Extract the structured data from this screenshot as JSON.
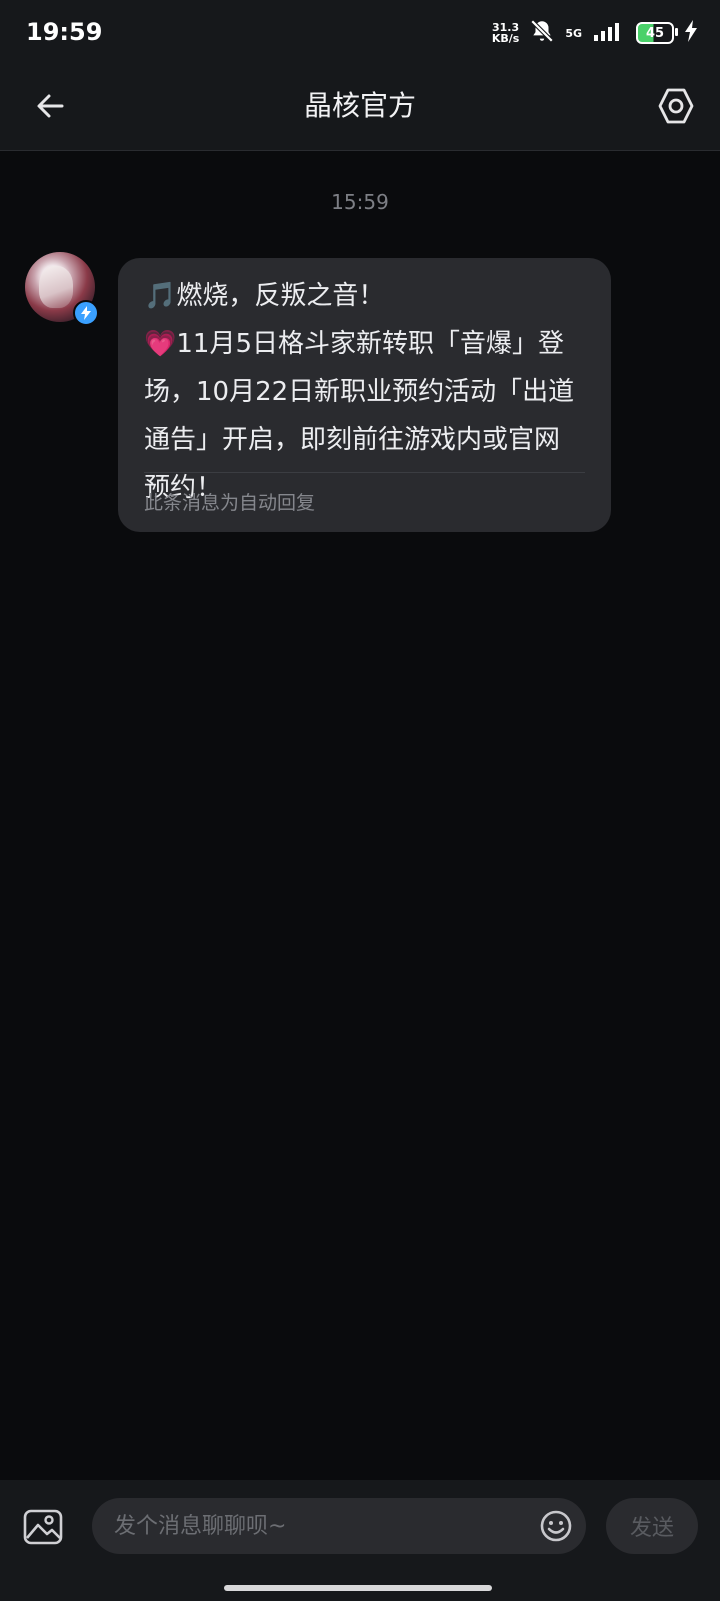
{
  "status_bar": {
    "time": "19:59",
    "net_speed_value": "31.3",
    "net_speed_unit": "KB/s",
    "network_type": "5G",
    "battery_level": "45"
  },
  "header": {
    "title": "晶核官方"
  },
  "chat": {
    "timestamp": "15:59",
    "messages": [
      {
        "text": "🎵燃烧，反叛之音！\n💗11月5日格斗家新转职「音爆」登场，10月22日新职业预约活动「出道通告」开启，即刻前往游戏内或官网预约！",
        "footer": "此条消息为自动回复"
      }
    ]
  },
  "composer": {
    "placeholder": "发个消息聊聊呗~",
    "send_label": "发送"
  },
  "colors": {
    "background": "#0a0b0d",
    "bar": "#16181b",
    "bubble": "#2a2b2f",
    "badge": "#3aa0ff"
  },
  "icons": [
    "back-arrow-icon",
    "settings-hex-icon",
    "image-icon",
    "emoji-icon",
    "verified-icon",
    "mute-icon",
    "signal-icon",
    "charging-icon"
  ]
}
